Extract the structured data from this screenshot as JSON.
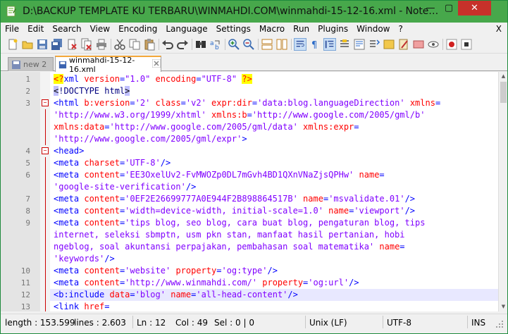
{
  "window": {
    "title": "D:\\BACKUP TEMPLATE KU TERBARU\\WINMAHDI.COM\\winmahdi-15-12-16.xml - Note…",
    "min_glyph": "—",
    "max_glyph": "▢",
    "close_glyph": "✕"
  },
  "menu": {
    "items": [
      "File",
      "Edit",
      "Search",
      "View",
      "Encoding",
      "Language",
      "Settings",
      "Macro",
      "Run",
      "Plugins",
      "Window",
      "?"
    ],
    "close_x": "X"
  },
  "toolbar": {
    "icons": [
      "new-file-icon",
      "open-file-icon",
      "save-icon",
      "save-all-icon",
      "close-icon",
      "close-all-icon",
      "print-icon",
      "cut-icon",
      "copy-icon",
      "paste-icon",
      "undo-icon",
      "redo-icon",
      "find-icon",
      "replace-icon",
      "zoom-in-icon",
      "zoom-out-icon",
      "sync-v-icon",
      "sync-h-icon",
      "word-wrap-icon",
      "show-all-chars-icon",
      "indent-guide-icon",
      "udl-icon",
      "doc-map-icon",
      "function-list-icon",
      "folder-icon",
      "monitor-icon",
      "record-icon",
      "stop-icon"
    ]
  },
  "tabs": [
    {
      "label": "new 2",
      "active": false
    },
    {
      "label": "winmahdi-15-12-16.xml",
      "active": true
    }
  ],
  "editor": {
    "current_line": "12",
    "rows": [
      {
        "ln": "1",
        "fold": "",
        "parts": [
          [
            "pi",
            "<?"
          ],
          [
            "tag",
            "xml "
          ],
          [
            "attr",
            "version"
          ],
          [
            "tag",
            "="
          ],
          [
            "val",
            "\"1.0\""
          ],
          [
            "tag",
            " "
          ],
          [
            "attr",
            "encoding"
          ],
          [
            "tag",
            "="
          ],
          [
            "val",
            "\"UTF-8\""
          ],
          [
            "tag",
            " "
          ],
          [
            "pi",
            "?>"
          ]
        ]
      },
      {
        "ln": "2",
        "fold": "",
        "parts": [
          [
            "brk",
            "<"
          ],
          [
            "dt",
            "!DOCTYPE html"
          ],
          [
            "brk",
            ">"
          ]
        ]
      },
      {
        "ln": "3",
        "fold": "box",
        "parts": [
          [
            "tag",
            "<html "
          ],
          [
            "attr",
            "b:version"
          ],
          [
            "tag",
            "="
          ],
          [
            "val",
            "'2'"
          ],
          [
            "tag",
            " "
          ],
          [
            "attr",
            "class"
          ],
          [
            "tag",
            "="
          ],
          [
            "val",
            "'v2'"
          ],
          [
            "tag",
            " "
          ],
          [
            "attr",
            "expr:dir"
          ],
          [
            "tag",
            "="
          ],
          [
            "val",
            "'data:blog.languageDirection'"
          ],
          [
            "tag",
            " "
          ],
          [
            "attr",
            "xmlns"
          ],
          [
            "tag",
            "="
          ]
        ]
      },
      {
        "ln": "",
        "fold": "line",
        "parts": [
          [
            "val",
            "'http://www.w3.org/1999/xhtml'"
          ],
          [
            "tag",
            " "
          ],
          [
            "attr",
            "xmlns:b"
          ],
          [
            "tag",
            "="
          ],
          [
            "val",
            "'http://www.google.com/2005/gml/b'"
          ]
        ]
      },
      {
        "ln": "",
        "fold": "line",
        "parts": [
          [
            "attr",
            "xmlns:data"
          ],
          [
            "tag",
            "="
          ],
          [
            "val",
            "'http://www.google.com/2005/gml/data'"
          ],
          [
            "tag",
            " "
          ],
          [
            "attr",
            "xmlns:expr"
          ],
          [
            "tag",
            "="
          ]
        ]
      },
      {
        "ln": "",
        "fold": "line",
        "parts": [
          [
            "val",
            "'http://www.google.com/2005/gml/expr'"
          ],
          [
            "tag",
            ">"
          ]
        ]
      },
      {
        "ln": "4",
        "fold": "box",
        "parts": [
          [
            "tag",
            "<head>"
          ]
        ]
      },
      {
        "ln": "5",
        "fold": "line",
        "parts": [
          [
            "tag",
            "<meta "
          ],
          [
            "attr",
            "charset"
          ],
          [
            "tag",
            "="
          ],
          [
            "val",
            "'UTF-8'"
          ],
          [
            "tag",
            "/>"
          ]
        ]
      },
      {
        "ln": "6",
        "fold": "line",
        "parts": [
          [
            "tag",
            "<meta "
          ],
          [
            "attr",
            "content"
          ],
          [
            "tag",
            "="
          ],
          [
            "val",
            "'EE3OxelUv2-FvMWOZp0DL7mGvh4BD1QXnVNaZjsQPHw'"
          ],
          [
            "tag",
            " "
          ],
          [
            "attr",
            "name"
          ],
          [
            "tag",
            "="
          ]
        ]
      },
      {
        "ln": "",
        "fold": "line",
        "parts": [
          [
            "val",
            "'google-site-verification'"
          ],
          [
            "tag",
            "/>"
          ]
        ]
      },
      {
        "ln": "7",
        "fold": "line",
        "parts": [
          [
            "tag",
            "<meta "
          ],
          [
            "attr",
            "content"
          ],
          [
            "tag",
            "="
          ],
          [
            "val",
            "'0EF2E26699777A0E944F2B898864517B'"
          ],
          [
            "tag",
            " "
          ],
          [
            "attr",
            "name"
          ],
          [
            "tag",
            "="
          ],
          [
            "val",
            "'msvalidate.01'"
          ],
          [
            "tag",
            "/>"
          ]
        ]
      },
      {
        "ln": "8",
        "fold": "line",
        "parts": [
          [
            "tag",
            "<meta "
          ],
          [
            "attr",
            "content"
          ],
          [
            "tag",
            "="
          ],
          [
            "val",
            "'width=device-width, initial-scale=1.0'"
          ],
          [
            "tag",
            " "
          ],
          [
            "attr",
            "name"
          ],
          [
            "tag",
            "="
          ],
          [
            "val",
            "'viewport'"
          ],
          [
            "tag",
            "/>"
          ]
        ]
      },
      {
        "ln": "9",
        "fold": "line",
        "parts": [
          [
            "tag",
            "<meta "
          ],
          [
            "attr",
            "content"
          ],
          [
            "tag",
            "="
          ],
          [
            "val",
            "'tips blog, seo blog, cara buat blog, pengaturan blog, tips"
          ]
        ]
      },
      {
        "ln": "",
        "fold": "line",
        "parts": [
          [
            "val",
            "internet, seleksi sbmptn, usm pkn stan, manfaat hasil pertanian, hobi"
          ]
        ]
      },
      {
        "ln": "",
        "fold": "line",
        "parts": [
          [
            "val",
            "ngeblog, soal akuntansi perpajakan, pembahasan soal matematika'"
          ],
          [
            "tag",
            " "
          ],
          [
            "attr",
            "name"
          ],
          [
            "tag",
            "="
          ]
        ]
      },
      {
        "ln": "",
        "fold": "line",
        "parts": [
          [
            "val",
            "'keywords'"
          ],
          [
            "tag",
            "/>"
          ]
        ]
      },
      {
        "ln": "10",
        "fold": "line",
        "parts": [
          [
            "tag",
            "<meta "
          ],
          [
            "attr",
            "content"
          ],
          [
            "tag",
            "="
          ],
          [
            "val",
            "'website'"
          ],
          [
            "tag",
            " "
          ],
          [
            "attr",
            "property"
          ],
          [
            "tag",
            "="
          ],
          [
            "val",
            "'og:type'"
          ],
          [
            "tag",
            "/>"
          ]
        ]
      },
      {
        "ln": "11",
        "fold": "line",
        "parts": [
          [
            "tag",
            "<meta "
          ],
          [
            "attr",
            "content"
          ],
          [
            "tag",
            "="
          ],
          [
            "val",
            "'http://www.winmahdi.com/'"
          ],
          [
            "tag",
            " "
          ],
          [
            "attr",
            "property"
          ],
          [
            "tag",
            "="
          ],
          [
            "val",
            "'og:url'"
          ],
          [
            "tag",
            "/>"
          ]
        ]
      },
      {
        "ln": "12",
        "fold": "line",
        "parts": [
          [
            "tag",
            "<b:include "
          ],
          [
            "attr",
            "data"
          ],
          [
            "tag",
            "="
          ],
          [
            "val",
            "'blog'"
          ],
          [
            "tag",
            " "
          ],
          [
            "attr",
            "name"
          ],
          [
            "tag",
            "="
          ],
          [
            "val",
            "'all-head-content'"
          ],
          [
            "tag",
            "/>"
          ]
        ]
      },
      {
        "ln": "13",
        "fold": "line",
        "parts": [
          [
            "tag",
            "<link "
          ],
          [
            "attr",
            "href"
          ],
          [
            "tag",
            "="
          ]
        ]
      }
    ]
  },
  "status": {
    "length": "length : 153.599",
    "lines": "lines : 2.603",
    "ln": "Ln : 12",
    "col": "Col : 49",
    "sel": "Sel : 0 | 0",
    "eol": "Unix (LF)",
    "encoding": "UTF-8",
    "mode": "INS"
  },
  "colors": {
    "title_bar": "#47a84b",
    "close_button": "#c7312a",
    "active_tab_accent": "#f4a83b",
    "current_line": "#e8e8ff"
  }
}
